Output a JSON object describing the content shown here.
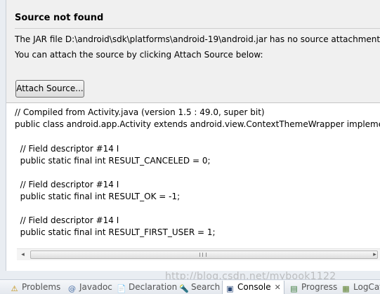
{
  "source_panel": {
    "title": "Source not found",
    "message_jar": "The JAR file D:\\android\\sdk\\platforms\\android-19\\android.jar has no source attachment.",
    "message_attach": "You can attach the source by clicking Attach Source below:",
    "attach_button": "Attach Source..."
  },
  "code": {
    "lines": [
      "// Compiled from Activity.java (version 1.5 : 49.0, super bit)",
      "public class android.app.Activity extends android.view.ContextThemeWrapper implements",
      "  // Field descriptor #14 I",
      "  public static final int RESULT_CANCELED = 0;",
      "  // Field descriptor #14 I",
      "  public static final int RESULT_OK = -1;",
      "  // Field descriptor #14 I",
      "  public static final int RESULT_FIRST_USER = 1;"
    ]
  },
  "scrollbar": {
    "left_arrow": "◂",
    "right_arrow": "▸"
  },
  "bottom_tabs": [
    {
      "label": "Problems",
      "icon": "problems-icon",
      "glyph": "⚠"
    },
    {
      "label": "Javadoc",
      "icon": "javadoc-icon",
      "glyph": "@"
    },
    {
      "label": "Declaration",
      "icon": "declaration-icon",
      "glyph": "📄"
    },
    {
      "label": "Search",
      "icon": "search-icon",
      "glyph": "🔦"
    },
    {
      "label": "Console",
      "icon": "console-icon",
      "glyph": "▣",
      "active": true,
      "close": "✕"
    },
    {
      "label": "Progress",
      "icon": "progress-icon",
      "glyph": "▤"
    },
    {
      "label": "LogCat",
      "icon": "logcat-icon",
      "glyph": "▦"
    }
  ],
  "watermark": "http://blog.csdn.net/mybook1122",
  "colors": {
    "header_bg": "#f0f0f0",
    "editor_bg": "#ffffff",
    "tabbar_bg": "#e4e8ee",
    "active_tab_bg": "#ffffff"
  }
}
